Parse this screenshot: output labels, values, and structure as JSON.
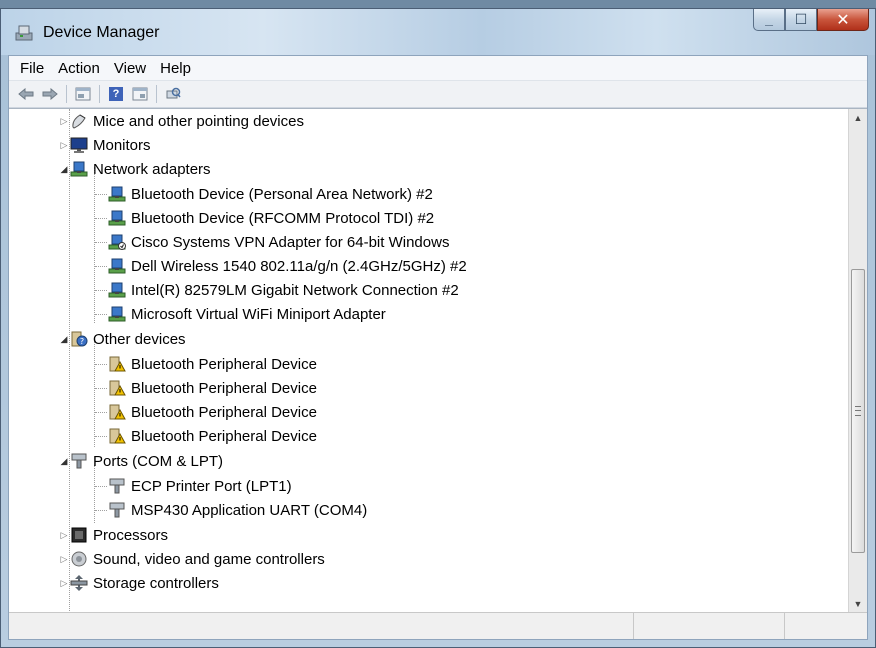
{
  "window": {
    "title": "Device Manager",
    "caption_buttons": [
      "minimize",
      "maximize",
      "close"
    ]
  },
  "menu": [
    "File",
    "Action",
    "View",
    "Help"
  ],
  "toolbar": {
    "buttons": [
      "back-arrow-icon",
      "forward-arrow-icon",
      "properties-icon",
      "help-icon",
      "show-hidden-icon",
      "scan-hardware-icon"
    ]
  },
  "tree": {
    "categories": [
      {
        "label": "Mice and other pointing devices",
        "expanded": false,
        "icon": "mouse-icon"
      },
      {
        "label": "Monitors",
        "expanded": false,
        "icon": "monitor-icon"
      },
      {
        "label": "Network adapters",
        "expanded": true,
        "icon": "network-adapter-icon",
        "children": [
          "Bluetooth Device (Personal Area Network) #2",
          "Bluetooth Device (RFCOMM Protocol TDI) #2",
          "Cisco Systems VPN Adapter for 64-bit Windows",
          "Dell Wireless 1540 802.11a/g/n (2.4GHz/5GHz) #2",
          "Intel(R) 82579LM Gigabit Network Connection #2",
          "Microsoft Virtual WiFi Miniport Adapter"
        ]
      },
      {
        "label": "Other devices",
        "expanded": true,
        "icon": "unknown-device-icon",
        "children": [
          "Bluetooth Peripheral Device",
          "Bluetooth Peripheral Device",
          "Bluetooth Peripheral Device",
          "Bluetooth Peripheral Device"
        ]
      },
      {
        "label": "Ports (COM & LPT)",
        "expanded": true,
        "icon": "port-icon",
        "children": [
          "ECP Printer Port (LPT1)",
          "MSP430 Application UART (COM4)"
        ]
      },
      {
        "label": "Processors",
        "expanded": false,
        "icon": "processor-icon"
      },
      {
        "label": "Sound, video and game controllers",
        "expanded": false,
        "icon": "speaker-icon"
      },
      {
        "label": "Storage controllers",
        "expanded": false,
        "icon": "storage-controller-icon"
      }
    ]
  },
  "colors": {
    "title_bar": "#c8daea",
    "close_button": "#c9553c",
    "tree_background": "#ffffff"
  }
}
